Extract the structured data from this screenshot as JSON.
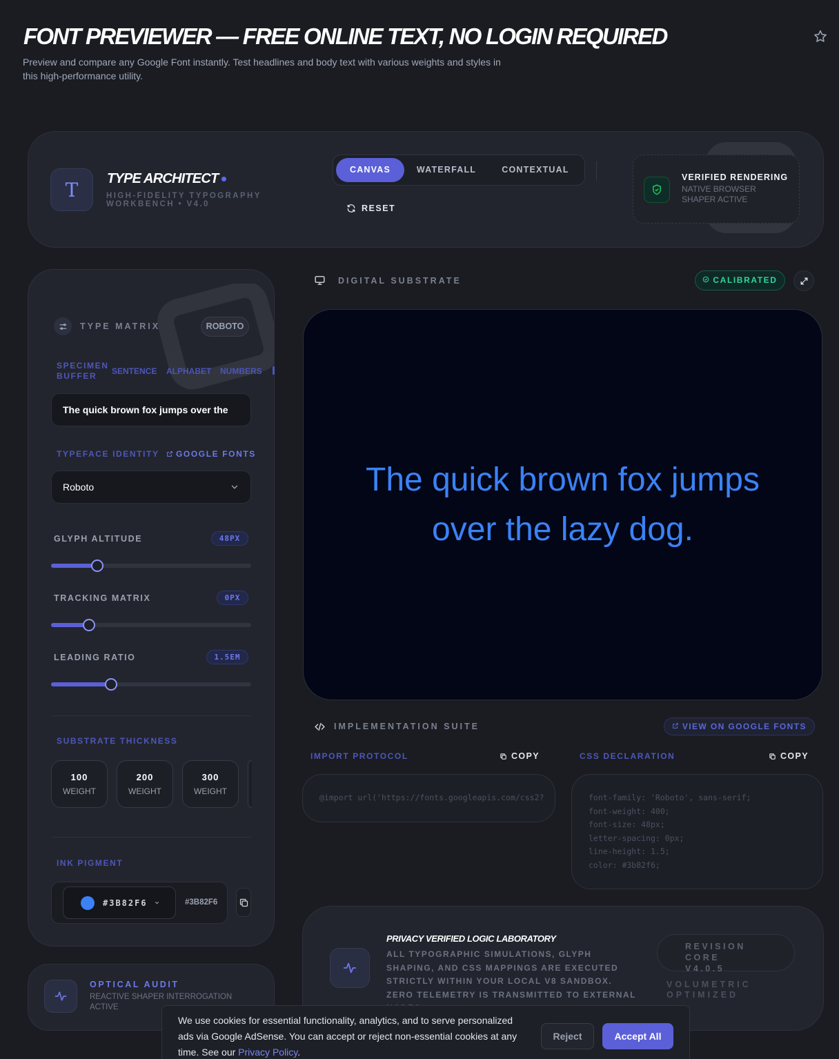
{
  "page": {
    "title": "FONT PREVIEWER — FREE ONLINE TEXT, NO LOGIN REQUIRED",
    "subtitle": "Preview and compare any Google Font instantly. Test headlines and body text with various weights and styles in this high-performance utility."
  },
  "header": {
    "logo_glyph": "T",
    "brand": "TYPE ARCHITECT",
    "tagline": "HIGH-FIDELITY TYPOGRAPHY WORKBENCH • V4.0",
    "tabs": [
      {
        "label": "CANVAS",
        "active": true
      },
      {
        "label": "WATERFALL",
        "active": false
      },
      {
        "label": "CONTEXTUAL",
        "active": false
      }
    ],
    "reset_label": "RESET",
    "verified_title": "VERIFIED RENDERING",
    "verified_sub": "NATIVE BROWSER SHAPER ACTIVE"
  },
  "sidebar": {
    "title": "TYPE MATRIX",
    "font_pill": "ROBOTO",
    "specimen_label": "SPECIMEN BUFFER",
    "specimen_tabs": [
      "SENTENCE",
      "ALPHABET",
      "NUMBERS"
    ],
    "specimen_text": "The quick brown fox jumps over the",
    "typeface_label": "TYPEFACE IDENTITY",
    "google_fonts_link": "GOOGLE FONTS",
    "typeface_value": "Roboto",
    "sliders": [
      {
        "label": "GLYPH ALTITUDE",
        "value": "48PX",
        "percent": 23
      },
      {
        "label": "TRACKING MATRIX",
        "value": "0PX",
        "percent": 19
      },
      {
        "label": "LEADING RATIO",
        "value": "1.5EM",
        "percent": 30
      }
    ],
    "thickness_label": "SUBSTRATE THICKNESS",
    "weights": [
      {
        "num": "100",
        "unit": "WEIGHT"
      },
      {
        "num": "200",
        "unit": "WEIGHT"
      },
      {
        "num": "300",
        "unit": "WEIGHT"
      }
    ],
    "ink_label": "INK PIGMENT",
    "ink_hex": "#3B82F6",
    "ink_hex_small": "#3B82F6",
    "ink_color": "#3b82f6"
  },
  "optical": {
    "title": "OPTICAL AUDIT",
    "sub": "REACTIVE SHAPER INTERROGATION ACTIVE"
  },
  "canvas": {
    "title": "DIGITAL SUBSTRATE",
    "status": "CALIBRATED",
    "preview_text": "The quick brown fox jumps over the lazy dog."
  },
  "impl": {
    "title": "IMPLEMENTATION SUITE",
    "view_link": "VIEW ON GOOGLE FONTS",
    "import_label": "IMPORT PROTOCOL",
    "css_label": "CSS DECLARATION",
    "copy_label": "COPY",
    "import_code": "@import url('https://fonts.googleapis.com/css2?",
    "css_lines": [
      "font-family: 'Roboto', sans-serif;",
      "font-weight: 400;",
      "font-size: 48px;",
      "letter-spacing: 0px;",
      "line-height: 1.5;",
      "color: #3b82f6;"
    ]
  },
  "privacy": {
    "title": "PRIVACY VERIFIED LOGIC LABORATORY",
    "body": "ALL TYPOGRAPHIC SIMULATIONS, GLYPH SHAPING, AND CSS MAPPINGS ARE EXECUTED STRICTLY WITHIN YOUR LOCAL V8 SANDBOX. ZERO TELEMETRY IS TRANSMITTED TO EXTERNAL NODES.",
    "revision": "REVISION CORE V4.0.5",
    "volumetric": "VOLUMETRIC OPTIMIZED"
  },
  "cookie": {
    "text": "We use cookies for essential functionality, analytics, and to serve personalized ads via Google AdSense. You can accept or reject non-essential cookies at any time. See our",
    "link": "Privacy Policy",
    "reject": "Reject",
    "accept": "Accept All"
  }
}
